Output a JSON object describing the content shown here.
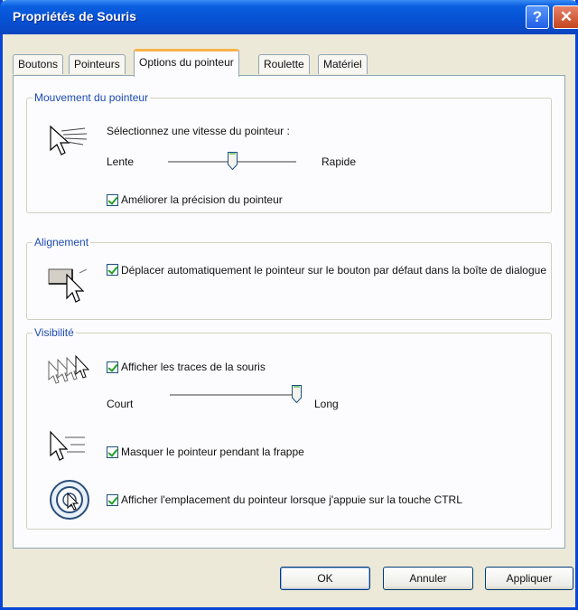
{
  "window": {
    "title": "Propriétés de Souris"
  },
  "title_buttons": {
    "help": "?",
    "close": "✕"
  },
  "tabs": [
    {
      "label": "Boutons"
    },
    {
      "label": "Pointeurs"
    },
    {
      "label": "Options du pointeur",
      "active": true
    },
    {
      "label": "Roulette"
    },
    {
      "label": "Matériel"
    }
  ],
  "motion": {
    "label": "Mouvement du pointeur",
    "speed_prompt": "Sélectionnez une vitesse du pointeur :",
    "slow": "Lente",
    "fast": "Rapide",
    "speed_level": 0.5,
    "enhance_precision": {
      "label": "Améliorer la précision du pointeur",
      "checked": true
    }
  },
  "snap": {
    "label": "Alignement",
    "snap_to": {
      "label": "Déplacer automatiquement le pointeur sur le bouton par défaut dans la boîte de dialogue",
      "checked": true
    }
  },
  "visibility": {
    "label": "Visibilité",
    "trails": {
      "label": "Afficher les traces de la souris",
      "checked": true
    },
    "short": "Court",
    "long": "Long",
    "trail_level": 1.0,
    "hide_typing": {
      "label": "Masquer le pointeur pendant la frappe",
      "checked": true
    },
    "show_ctrl": {
      "label": "Afficher l'emplacement du pointeur lorsque j'appuie sur la touche CTRL",
      "checked": true
    }
  },
  "buttons": {
    "ok": "OK",
    "cancel": "Annuler",
    "apply": "Appliquer"
  },
  "colors": {
    "title_blue": "#0a5fe0",
    "group_label": "#1c4ab0",
    "check_green": "#21a121",
    "active_tab_highlight": "#f9b34b"
  }
}
